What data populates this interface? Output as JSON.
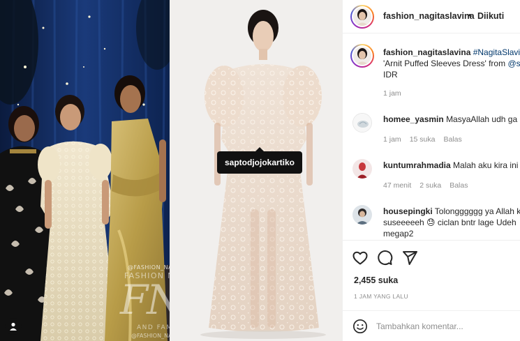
{
  "post": {
    "author": "fashion_nagitaslavina",
    "dot": "•",
    "follow_status": "Diikuti",
    "caption": {
      "user": "fashion_nagitaslavina",
      "hashtag": "#NagitaSlavina",
      "line2_prefix": "'Arnit Puffed Sleeves Dress' from ",
      "line2_mention": "@s",
      "line3": "IDR",
      "time": "1 jam"
    },
    "image_tag": "saptodjojokartiko",
    "watermark": {
      "handle_top": "@FASHION_NAGITASLAVINA",
      "title": "FASHION NAGITA SLAVINA",
      "monogram": "FNS",
      "family": "AND FAMILY",
      "handle_bottom": "@FASHION_NAGITASLAVINA"
    }
  },
  "comments": [
    {
      "user": "homee_yasmin",
      "text": "MasyaAllah udh ga k",
      "time": "1 jam",
      "likes": "15 suka",
      "reply": "Balas"
    },
    {
      "user": "kuntumrahmadia",
      "text": "Malah aku kira ini",
      "time": "47 menit",
      "likes": "2 suka",
      "reply": "Balas"
    },
    {
      "user": "housepingki",
      "text_line1": "Tolongggggg ya Allah kr",
      "text_line2": "suseeeeeh 😓 ciclan bntr lage Udeh",
      "text_line3": "megap2"
    }
  ],
  "stats": {
    "likes": "2,455 suka",
    "time_ago": "1 JAM YANG LALU"
  },
  "add_comment": {
    "placeholder": "Tambahkan komentar..."
  },
  "icons": [
    "heart-icon",
    "comment-icon",
    "share-icon",
    "emoji-icon",
    "user-tag-icon"
  ],
  "colors": {
    "text": "#262626",
    "muted": "#8e8e8e",
    "link": "#00376b",
    "border": "#efefef"
  }
}
